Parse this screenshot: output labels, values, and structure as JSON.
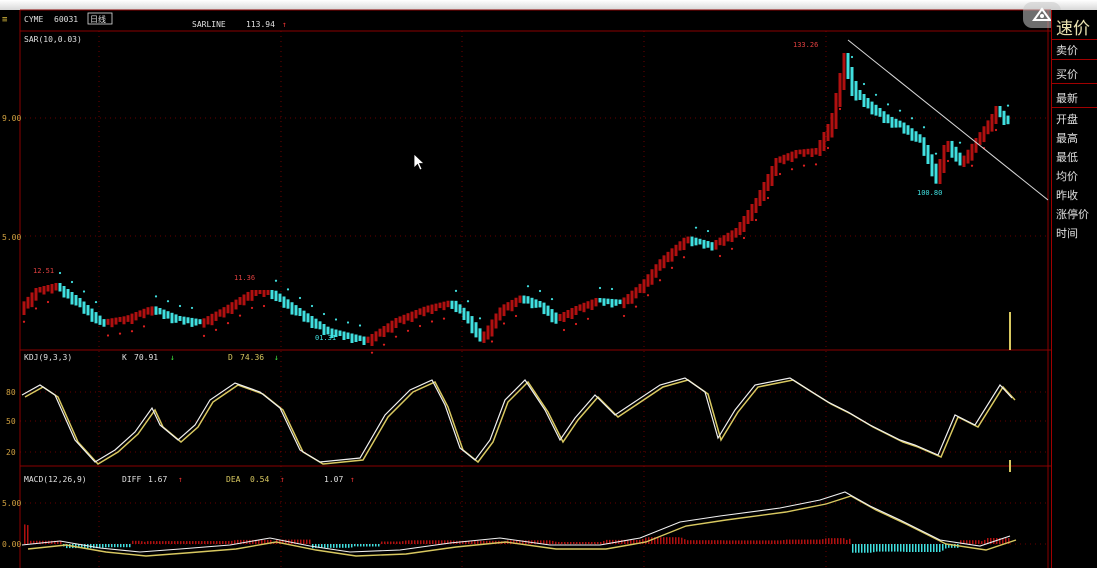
{
  "header": {
    "code_label": "CYME",
    "code_value": "60031",
    "mode_label": "日线",
    "indicator": "SARLINE",
    "indicator_value": "113.94",
    "indicator_arrow": "↑"
  },
  "main_chart": {
    "legend": "SAR(10,0.03)",
    "y_labels": [
      "9.00",
      "5.00"
    ],
    "price_labels": {
      "left_peak": "12.51",
      "mid_peak": "11.36",
      "left_low": "01.31",
      "top_peak": "133.26",
      "right_low": "100.80"
    }
  },
  "kdj": {
    "legend": "KDJ(9,3,3)",
    "k_label": "K",
    "k_value": "70.91",
    "k_arrow": "↓",
    "d_label": "D",
    "d_value": "74.36",
    "d_arrow": "↓",
    "y_labels": [
      "80",
      "50",
      "20"
    ]
  },
  "macd": {
    "legend": "MACD(12,26,9)",
    "diff_label": "DIFF",
    "diff_value": "1.67",
    "diff_arrow": "↑",
    "dea_label": "DEA",
    "dea_value": "0.54",
    "dea_arrow": "↑",
    "macd_value": "1.07",
    "macd_arrow": "↑",
    "y_labels": [
      "5.00",
      "0.00"
    ]
  },
  "side_panel": {
    "title": "速价",
    "items": [
      "卖价",
      "买价",
      "最新",
      "开盘",
      "最高",
      "最低",
      "均价",
      "昨收",
      "涨停价",
      "时间"
    ]
  },
  "colors": {
    "up_candle": "#b01010",
    "down_candle": "#40e0e0",
    "sar_up": "#e02020",
    "sar_down": "#40e0e0",
    "k_line": "#f0f0f0",
    "d_line": "#d8c860",
    "grid": "#8a0000",
    "label": "#d0a040"
  },
  "icons": {
    "logo": "app-logo-icon",
    "cursor": "mouse-pointer-icon"
  }
}
